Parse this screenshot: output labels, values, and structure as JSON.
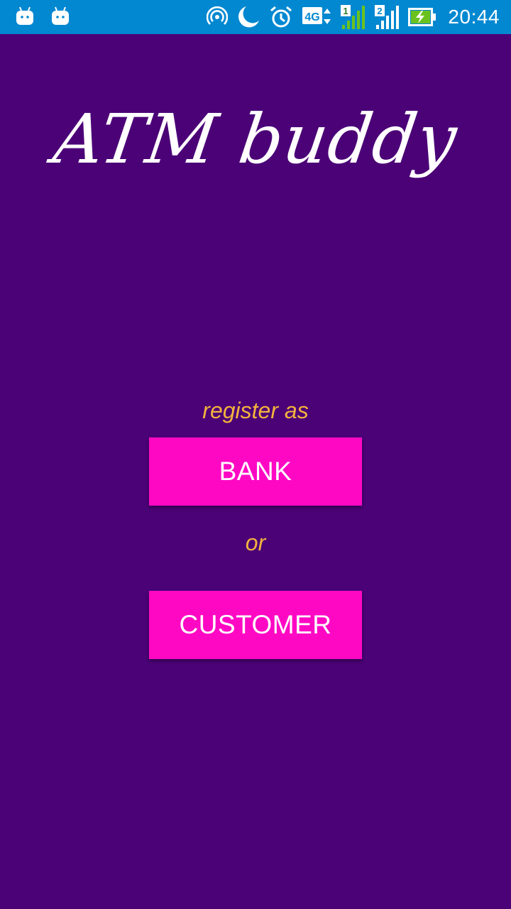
{
  "status_bar": {
    "time": "20:44",
    "left_icons": [
      "android-notification-icon",
      "android-notification-icon"
    ],
    "right_icons": [
      "hotspot-icon",
      "do-not-disturb-moon-icon",
      "alarm-icon",
      "4g-data-icon",
      "signal-sim1-icon",
      "signal-sim2-icon",
      "battery-charging-icon"
    ],
    "network_label": "4G",
    "sim1_label": "1",
    "sim2_label": "2",
    "color": "#0288d1"
  },
  "app": {
    "title": "ATM buddy",
    "register_label": "register as",
    "or_label": "or",
    "background_color": "#4b0277",
    "accent_text_color": "#f3b33d"
  },
  "buttons": {
    "bank_label": "BANK",
    "customer_label": "CUSTOMER",
    "color": "#ff08c4"
  }
}
